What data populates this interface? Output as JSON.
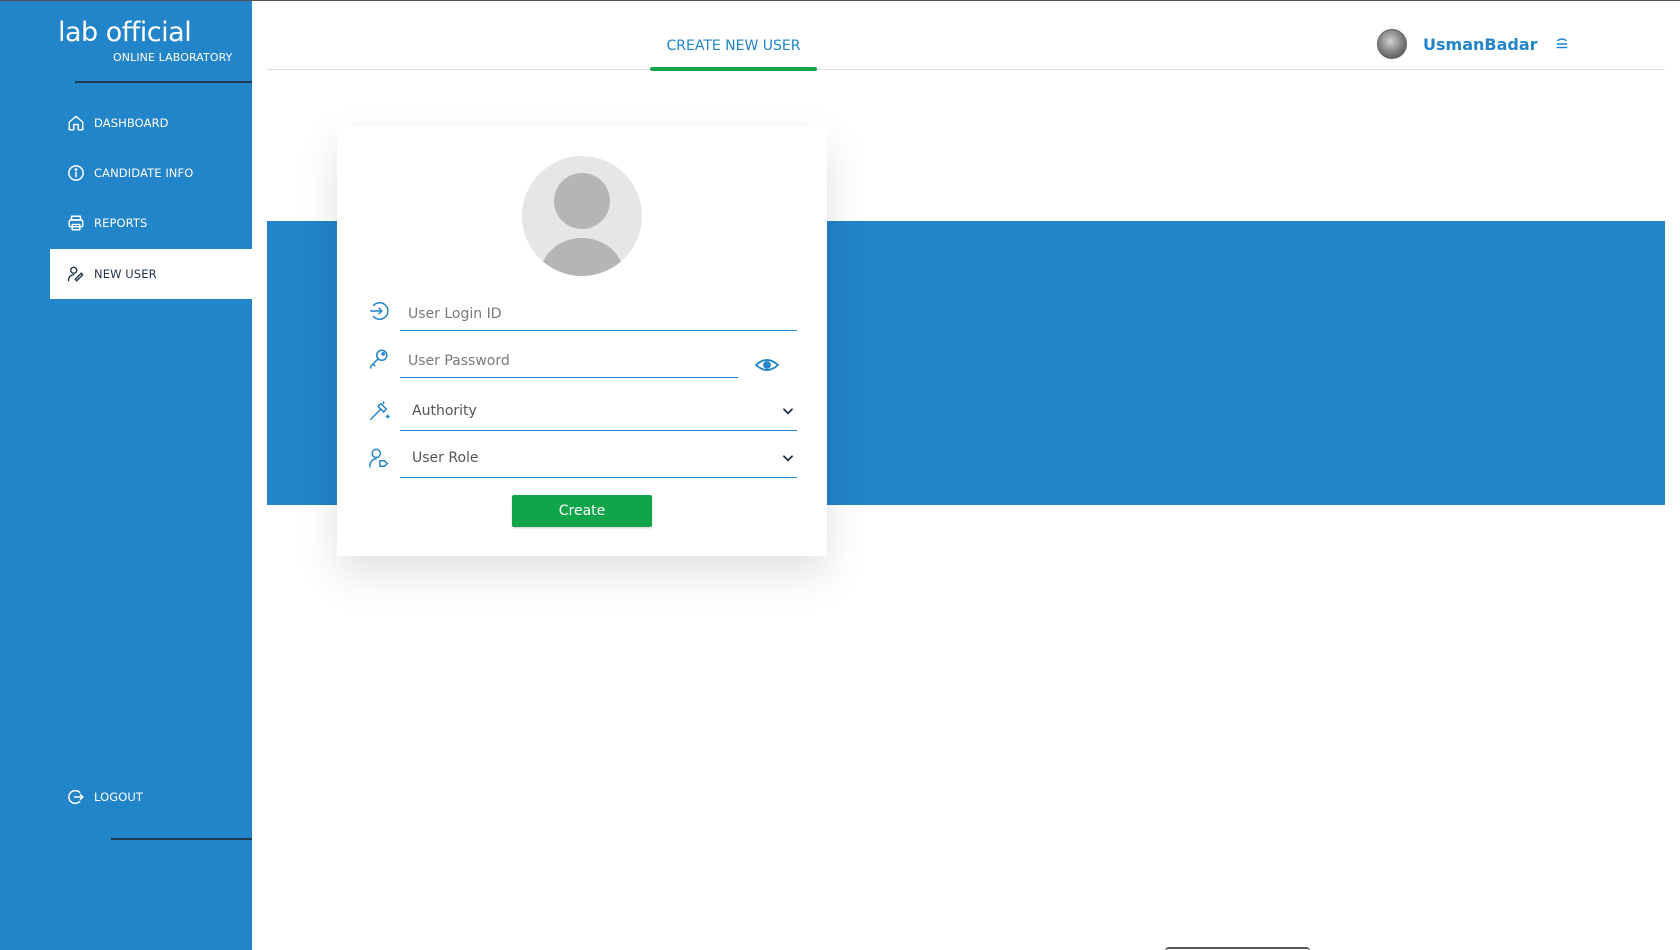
{
  "brand": {
    "title": "lab official",
    "subtitle": "ONLINE LABORATORY"
  },
  "sidebar": {
    "items": [
      {
        "label": "DASHBOARD",
        "icon": "home-icon"
      },
      {
        "label": "CANDIDATE INFO",
        "icon": "info-icon"
      },
      {
        "label": "REPORTS",
        "icon": "printer-icon"
      },
      {
        "label": "NEW USER",
        "icon": "user-edit-icon",
        "active": true
      }
    ],
    "logout": {
      "label": "LOGOUT",
      "icon": "logout-icon"
    }
  },
  "header": {
    "tab": "CREATE NEW USER",
    "username": "UsmanBadar",
    "menu_icon": "hamburger-icon"
  },
  "form": {
    "login_placeholder": "User Login ID",
    "password_placeholder": "User Password",
    "authority_label": "Authority",
    "role_label": "User Role",
    "create_label": "Create"
  },
  "colors": {
    "primary": "#2284c9",
    "accent": "#11a54a",
    "nav_dark": "#1e3045"
  }
}
